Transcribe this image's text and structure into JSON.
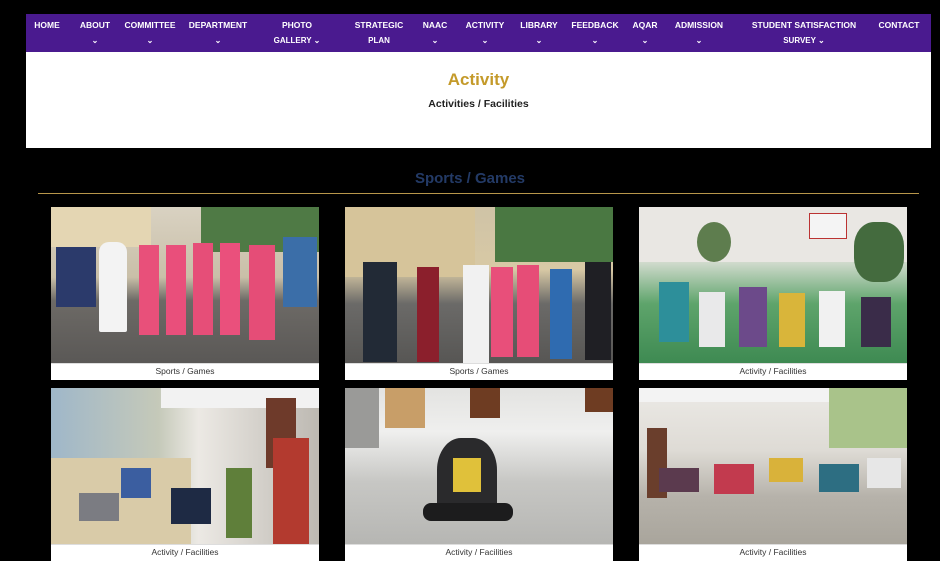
{
  "nav": {
    "items": [
      {
        "label": "HOME",
        "sub": ""
      },
      {
        "label": "ABOUT",
        "sub": "⌄"
      },
      {
        "label": "COMMITTEE",
        "sub": "⌄"
      },
      {
        "label": "DEPARTMENT",
        "sub": "⌄"
      },
      {
        "label": "PHOTO",
        "sub": "GALLERY ⌄"
      },
      {
        "label": "STRATEGIC",
        "sub": "PLAN"
      },
      {
        "label": "NAAC",
        "sub": "⌄"
      },
      {
        "label": "ACTIVITY",
        "sub": "⌄"
      },
      {
        "label": "LIBRARY",
        "sub": "⌄"
      },
      {
        "label": "FEEDBACK",
        "sub": "⌄"
      },
      {
        "label": "AQAR",
        "sub": "⌄"
      },
      {
        "label": "ADMISSION",
        "sub": "⌄"
      },
      {
        "label": "STUDENT SATISFACTION",
        "sub": "SURVEY ⌄"
      },
      {
        "label": "CONTACT",
        "sub": ""
      }
    ]
  },
  "header": {
    "title": "Activity",
    "breadcrumb": "Activities / Facilities"
  },
  "section": {
    "title": "Sports / Games"
  },
  "gallery": [
    {
      "caption": "Sports / Games"
    },
    {
      "caption": "Sports / Games"
    },
    {
      "caption": "Activity / Facilities"
    },
    {
      "caption": "Activity / Facilities"
    },
    {
      "caption": "Activity / Facilities"
    },
    {
      "caption": "Activity / Facilities"
    }
  ],
  "colors": {
    "nav_bg": "#4a1a8f",
    "title_gold": "#c49a2a",
    "section_navy": "#233a66",
    "page_bg": "#000000"
  }
}
